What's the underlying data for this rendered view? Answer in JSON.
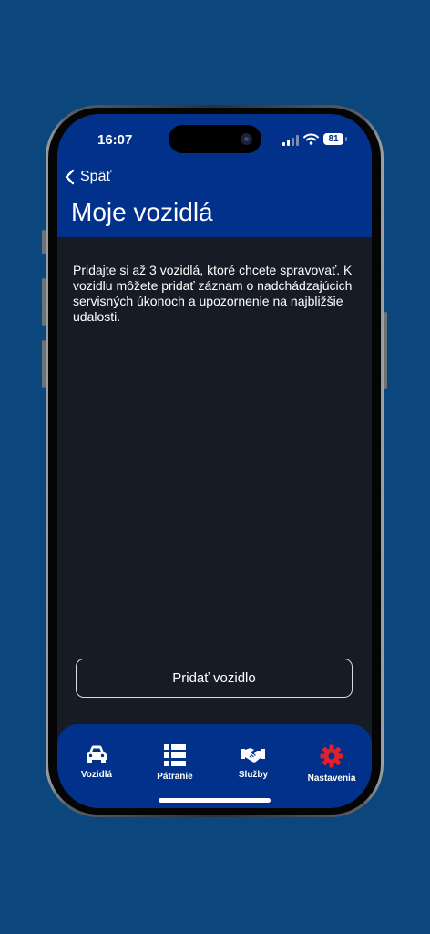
{
  "status": {
    "time": "16:07",
    "battery": "81"
  },
  "nav": {
    "back_label": "Späť",
    "title": "Moje vozidlá"
  },
  "main": {
    "intro": " Pridajte si až 3 vozidlá, ktoré chcete spravovať. K vozidlu môžete pridať záznam o nadchádzajúcich servisných úkonoch a upozornenie na najbližšie udalosti.",
    "add_button": "Pridať vozidlo"
  },
  "tabbar": {
    "items": [
      {
        "label": "Vozidlá",
        "icon": "car-icon"
      },
      {
        "label": "Pátranie",
        "icon": "list-icon"
      },
      {
        "label": "Služby",
        "icon": "handshake-icon"
      },
      {
        "label": "Nastavenia",
        "icon": "gear-icon"
      }
    ]
  },
  "colors": {
    "background": "#0b467d",
    "header": "#01318a",
    "screen": "#161b26",
    "gear": "#e0202c"
  }
}
